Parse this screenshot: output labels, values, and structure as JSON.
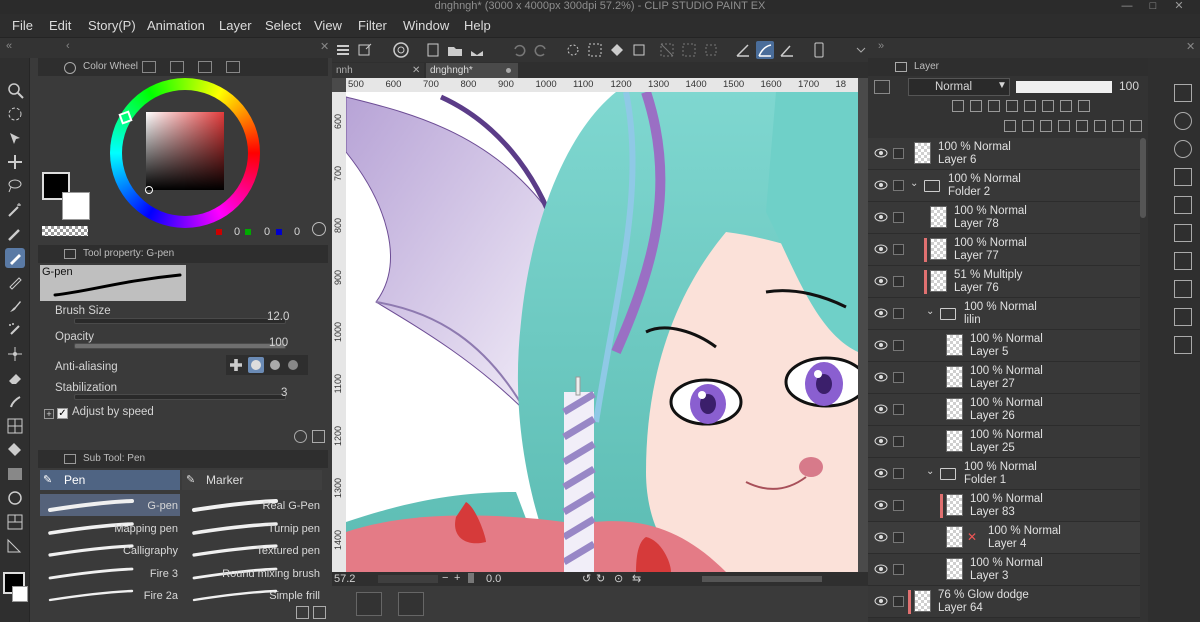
{
  "window": {
    "title": "dnghngh* (3000 x 4000px 300dpi 57.2%) - CLIP STUDIO PAINT EX"
  },
  "menu": [
    "File",
    "Edit",
    "Story(P)",
    "Animation",
    "Layer",
    "Select",
    "View",
    "Filter",
    "Window",
    "Help"
  ],
  "color_panel": {
    "title": "Color Wheel",
    "r": "0",
    "g": "0",
    "b": "0",
    "colors": {
      "main": "#000000",
      "sub": "#ffffff"
    }
  },
  "tool_property": {
    "title": "Tool property: G-pen",
    "tool_name": "G-pen",
    "brush_size_label": "Brush Size",
    "brush_size_value": "12.0",
    "opacity_label": "Opacity",
    "opacity_value": "100",
    "antialias_label": "Anti-aliasing",
    "stabilization_label": "Stabilization",
    "stabilization_value": "3",
    "adjust_label": "Adjust by speed"
  },
  "sub_tool": {
    "title": "Sub Tool: Pen",
    "tabs": [
      "Pen",
      "Marker"
    ],
    "brushes": [
      {
        "left": "G-pen",
        "right": "Real G-Pen"
      },
      {
        "left": "Mapping pen",
        "right": "Turnip pen"
      },
      {
        "left": "Calligraphy",
        "right": "Textured pen"
      },
      {
        "left": "Fire 3",
        "right": "Round mixing brush"
      },
      {
        "left": "Fire 2a",
        "right": "Simple frill"
      }
    ]
  },
  "canvas": {
    "tabs": [
      "nnh",
      "dnghngh*"
    ],
    "ruler_h": [
      "500",
      "600",
      "700",
      "800",
      "900",
      "1000",
      "1100",
      "1200",
      "1300",
      "1400",
      "1500",
      "1600",
      "1700",
      "18"
    ],
    "ruler_v": [
      "600",
      "700",
      "800",
      "900",
      "1000",
      "1100",
      "1200",
      "1300",
      "1400"
    ],
    "zoom": "57.2",
    "rotation": "0.0"
  },
  "layer_panel": {
    "title": "Layer",
    "blend_mode": "Normal",
    "opacity": "100",
    "layers": [
      {
        "p": "100 % Normal",
        "n": "Layer 6",
        "indent": 0,
        "folder": false,
        "red": false
      },
      {
        "p": "100 % Normal",
        "n": "Folder 2",
        "indent": 0,
        "folder": true,
        "red": false
      },
      {
        "p": "100 % Normal",
        "n": "Layer 78",
        "indent": 1,
        "folder": false,
        "red": false
      },
      {
        "p": "100 % Normal",
        "n": "Layer 77",
        "indent": 1,
        "folder": false,
        "red": true
      },
      {
        "p": "51 % Multiply",
        "n": "Layer 76",
        "indent": 1,
        "folder": false,
        "red": true
      },
      {
        "p": "100 % Normal",
        "n": "lilin",
        "indent": 1,
        "folder": true,
        "red": false
      },
      {
        "p": "100 % Normal",
        "n": "Layer 5",
        "indent": 2,
        "folder": false,
        "red": false
      },
      {
        "p": "100 % Normal",
        "n": "Layer 27",
        "indent": 2,
        "folder": false,
        "red": false
      },
      {
        "p": "100 % Normal",
        "n": "Layer 26",
        "indent": 2,
        "folder": false,
        "red": false
      },
      {
        "p": "100 % Normal",
        "n": "Layer 25",
        "indent": 2,
        "folder": false,
        "red": false
      },
      {
        "p": "100 % Normal",
        "n": "Folder 1",
        "indent": 1,
        "folder": true,
        "red": false
      },
      {
        "p": "100 % Normal",
        "n": "Layer 83",
        "indent": 2,
        "folder": false,
        "red": true
      },
      {
        "p": "100 % Normal",
        "n": "Layer 4",
        "indent": 2,
        "folder": false,
        "red": false,
        "selected": true
      },
      {
        "p": "100 % Normal",
        "n": "Layer 3",
        "indent": 2,
        "folder": false,
        "red": false
      },
      {
        "p": "76 % Glow dodge",
        "n": "Layer 64",
        "indent": 0,
        "folder": false,
        "red": true
      }
    ]
  }
}
